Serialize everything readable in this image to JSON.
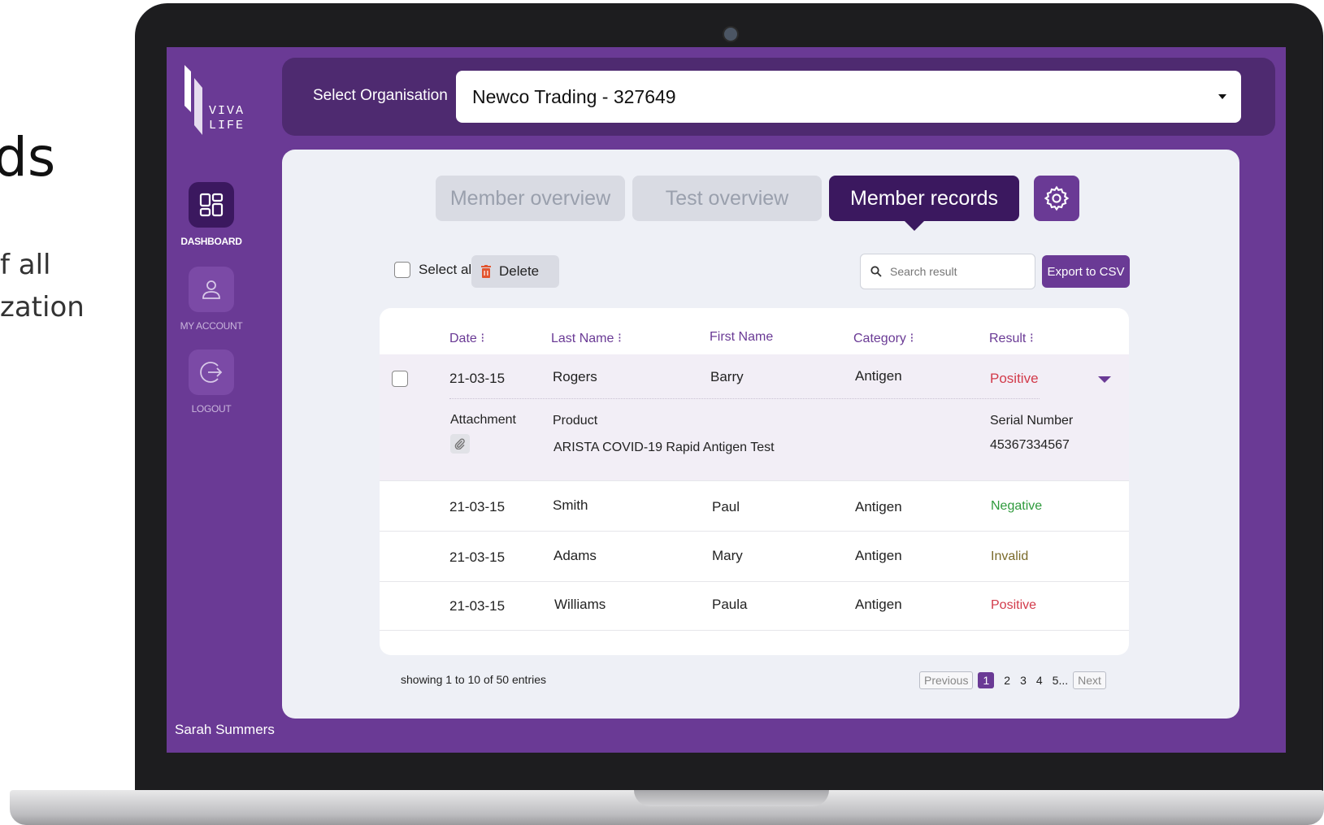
{
  "marketing": {
    "heading_fragment": "ds",
    "line1": "f all",
    "line2": "zation"
  },
  "app": {
    "logo_text": "VIVA LIFE",
    "user_name": "Sarah Summers"
  },
  "sidebar": {
    "items": [
      {
        "label": "DASHBOARD",
        "icon": "dashboard-icon",
        "active": true
      },
      {
        "label": "MY ACCOUNT",
        "icon": "user-icon",
        "active": false
      },
      {
        "label": "LOGOUT",
        "icon": "logout-icon",
        "active": false
      }
    ]
  },
  "org": {
    "label": "Select Organisation",
    "value": "Newco Trading - 327649"
  },
  "tabs": [
    {
      "label": "Member overview",
      "active": false
    },
    {
      "label": "Test overview",
      "active": false
    },
    {
      "label": "Member records",
      "active": true
    }
  ],
  "toolbar": {
    "select_all_label": "Select all",
    "delete_label": "Delete",
    "search_placeholder": "Search result",
    "export_label": "Export to CSV"
  },
  "table": {
    "headers": {
      "date": "Date ⁝",
      "last_name": "Last Name ⁝",
      "first_name": "First Name",
      "category": "Category ⁝",
      "result": "Result ⁝"
    },
    "rows": [
      {
        "date": "21-03-15",
        "last_name": "Rogers",
        "first_name": "Barry",
        "category": "Antigen",
        "result": "Positive",
        "status": "positive"
      },
      {
        "date": "21-03-15",
        "last_name": "Smith",
        "first_name": "Paul",
        "category": "Antigen",
        "result": "Negative",
        "status": "negative"
      },
      {
        "date": "21-03-15",
        "last_name": "Adams",
        "first_name": "Mary",
        "category": "Antigen",
        "result": "Invalid",
        "status": "invalid"
      },
      {
        "date": "21-03-15",
        "last_name": "Williams",
        "first_name": "Paula",
        "category": "Antigen",
        "result": "Positive",
        "status": "positive"
      }
    ],
    "expanded": {
      "attachment_label": "Attachment",
      "product_label": "Product",
      "product_value": "ARISTA COVID-19 Rapid Antigen Test",
      "serial_label": "Serial Number",
      "serial_value": "45367334567"
    }
  },
  "pagination": {
    "showing": "showing 1 to 10 of 50 entries",
    "previous": "Previous",
    "pages": [
      "1",
      "2",
      "3",
      "4",
      "5"
    ],
    "ellipsis": "...",
    "next": "Next",
    "current": "1"
  },
  "colors": {
    "brand_purple": "#6a3a95",
    "dark_purple": "#3b185f",
    "positive": "#d23a4a",
    "negative": "#2e9a3c",
    "invalid": "#7a6a2a"
  }
}
